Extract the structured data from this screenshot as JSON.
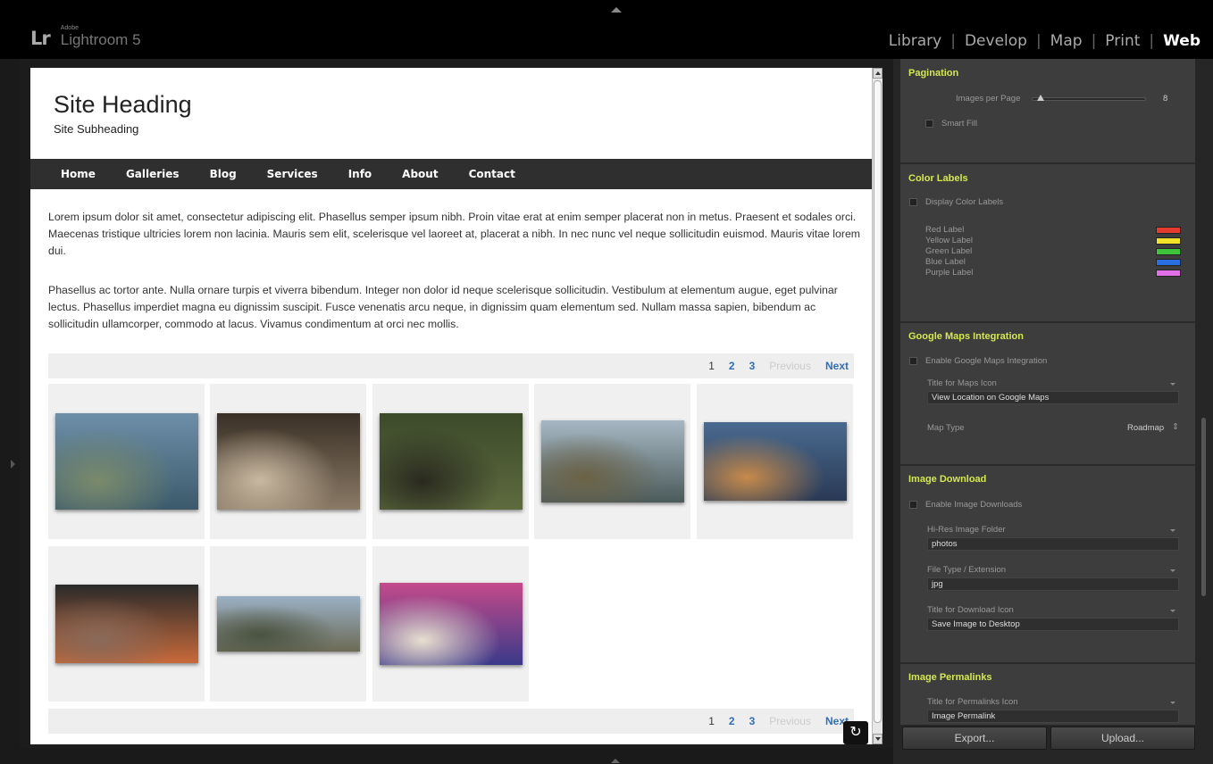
{
  "app": {
    "logo_mark": "Lr",
    "vendor": "Adobe",
    "name": "Lightroom 5"
  },
  "modules": [
    {
      "label": "Library"
    },
    {
      "label": "Develop"
    },
    {
      "label": "Map"
    },
    {
      "label": "Print"
    },
    {
      "label": "Web",
      "active": true
    }
  ],
  "module_separator": "|",
  "site": {
    "heading": "Site Heading",
    "subheading": "Site Subheading",
    "nav": [
      "Home",
      "Galleries",
      "Blog",
      "Services",
      "Info",
      "About",
      "Contact"
    ],
    "paragraphs": [
      "Lorem ipsum dolor sit amet, consectetur adipiscing elit. Phasellus semper ipsum nibh. Proin vitae erat at enim semper placerat non in metus. Praesent et sodales orci. Maecenas tristique ultricies lorem non lacinia. Mauris sem elit, scelerisque vel laoreet at, placerat a nibh. In nec nunc vel neque sollicitudin euismod. Mauris vitae lorem dui.",
      "Phasellus ac tortor ante. Nulla ornare turpis et viverra bibendum. Integer non dolor id neque scelerisque sollicitudin. Vestibulum at elementum augue, eget pulvinar lectus. Phasellus imperdiet magna eu dignissim suscipit. Fusce venenatis arcu neque, in dignissim quam elementum sed. Nullam massa sapien, bibendum ac sollicitudin ullamcorper, commodo at lacus. Vivamus condimentum at orci nec mollis."
    ],
    "pager": {
      "pages": [
        "1",
        "2",
        "3"
      ],
      "current_page": "1",
      "previous": "Previous",
      "next": "Next"
    },
    "thumbnails": [
      {
        "name": "stilt-house-photo",
        "colors": [
          "#6d8fa8",
          "#3b5a6b",
          "#7a8a6a"
        ]
      },
      {
        "name": "elderly-woman-photo",
        "colors": [
          "#3a3026",
          "#8a7a66",
          "#c8b8a0"
        ]
      },
      {
        "name": "forest-ruins-photo",
        "colors": [
          "#3b4a2a",
          "#5e6b3f",
          "#2a2a1f"
        ]
      },
      {
        "name": "river-boats-photo",
        "colors": [
          "#a7b8c4",
          "#4b5a5a",
          "#6b6245"
        ]
      },
      {
        "name": "canal-town-night-photo",
        "colors": [
          "#4a6a8f",
          "#2a3a55",
          "#c78a4a"
        ]
      },
      {
        "name": "fish-market-photo",
        "colors": [
          "#2a2a2a",
          "#c86a3a",
          "#8a6a5a"
        ]
      },
      {
        "name": "coastal-village-photo",
        "colors": [
          "#9ab0c4",
          "#6b6a55",
          "#4a5240"
        ]
      },
      {
        "name": "graffiti-wall-photo",
        "colors": [
          "#c44a8a",
          "#3a3a8a",
          "#e8e0d0"
        ]
      }
    ]
  },
  "panel": {
    "pagination": {
      "title": "Pagination",
      "images_per_page_label": "Images per Page",
      "images_per_page_value": "8",
      "smart_fill_label": "Smart Fill"
    },
    "color_labels": {
      "title": "Color Labels",
      "display_label": "Display Color Labels",
      "labels": [
        {
          "name": "Red Label",
          "color": "#e53a2e"
        },
        {
          "name": "Yellow Label",
          "color": "#f2e22a"
        },
        {
          "name": "Green Label",
          "color": "#3ec43a"
        },
        {
          "name": "Blue Label",
          "color": "#2a6fe0"
        },
        {
          "name": "Purple Label",
          "color": "#e070e8"
        }
      ]
    },
    "google_maps": {
      "title": "Google Maps Integration",
      "enable_label": "Enable Google Maps Integration",
      "icon_title_label": "Title for Maps Icon",
      "icon_title_value": "View Location on Google Maps",
      "map_type_label": "Map Type",
      "map_type_value": "Roadmap"
    },
    "image_download": {
      "title": "Image Download",
      "enable_label": "Enable Image Downloads",
      "folder_label": "Hi-Res Image Folder",
      "folder_value": "photos",
      "filetype_label": "File Type / Extension",
      "filetype_value": "jpg",
      "download_icon_label": "Title for Download Icon",
      "download_icon_value": "Save Image to Desktop"
    },
    "permalinks": {
      "title": "Image Permalinks",
      "icon_title_label": "Title for Permalinks Icon",
      "icon_title_value": "Image Permalink"
    },
    "export_label": "Export...",
    "upload_label": "Upload..."
  },
  "icons": {
    "refresh": "↻",
    "stepper": "⇕"
  }
}
